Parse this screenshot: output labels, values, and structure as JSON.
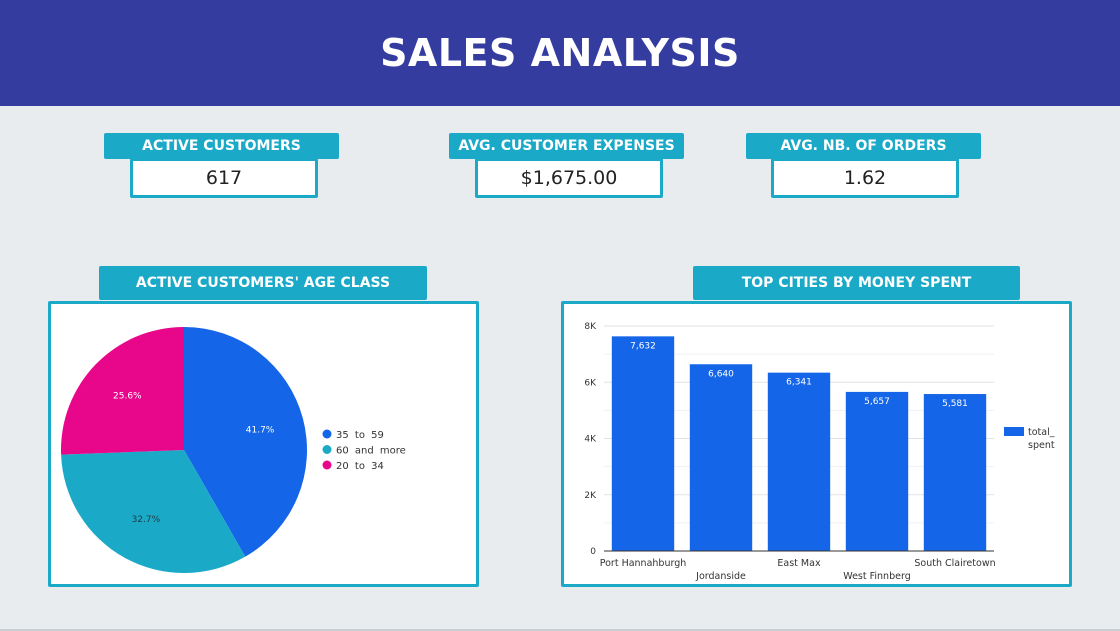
{
  "header": {
    "title": "SALES ANALYSIS"
  },
  "kpis": [
    {
      "label": "ACTIVE CUSTOMERS",
      "value": "617"
    },
    {
      "label": "AVG. CUSTOMER EXPENSES",
      "value": "$1,675.00"
    },
    {
      "label": "AVG. NB. OF ORDERS",
      "value": "1.62"
    }
  ],
  "panels": {
    "pie_title": "ACTIVE CUSTOMERS' AGE CLASS",
    "bar_title": "TOP CITIES BY MONEY SPENT"
  },
  "colors": {
    "header": "#343ca0",
    "accent": "#1aaac8",
    "bar": "#1565e8",
    "pie_35_59": "#1565e8",
    "pie_60_more": "#1aaac8",
    "pie_20_34": "#e8068a"
  },
  "chart_data": [
    {
      "type": "pie",
      "title": "ACTIVE CUSTOMERS' AGE CLASS",
      "labels": [
        "35 to 59",
        "60 and more",
        "20 to 34"
      ],
      "values": [
        41.7,
        32.7,
        25.6
      ],
      "value_labels": [
        "41.7%",
        "32.7%",
        "25.6%"
      ],
      "colors": [
        "#1565e8",
        "#1aaac8",
        "#e8068a"
      ],
      "legend": "right"
    },
    {
      "type": "bar",
      "title": "TOP CITIES BY MONEY SPENT",
      "categories": [
        "Port Hannahburgh",
        "Jordanside",
        "East Max",
        "West Finnberg",
        "South Clairetown"
      ],
      "series": [
        {
          "name": "total_spent",
          "legend_lines": [
            "total_",
            "spent"
          ],
          "values": [
            7632,
            6640,
            6341,
            5657,
            5581
          ]
        }
      ],
      "value_labels": [
        "7,632",
        "6,640",
        "6,341",
        "5,657",
        "5,581"
      ],
      "ylim": [
        0,
        8000
      ],
      "yticks": [
        0,
        2000,
        4000,
        6000,
        8000
      ],
      "ytick_labels": [
        "0",
        "2K",
        "4K",
        "6K",
        "8K"
      ],
      "grid": true,
      "legend": "right"
    }
  ]
}
